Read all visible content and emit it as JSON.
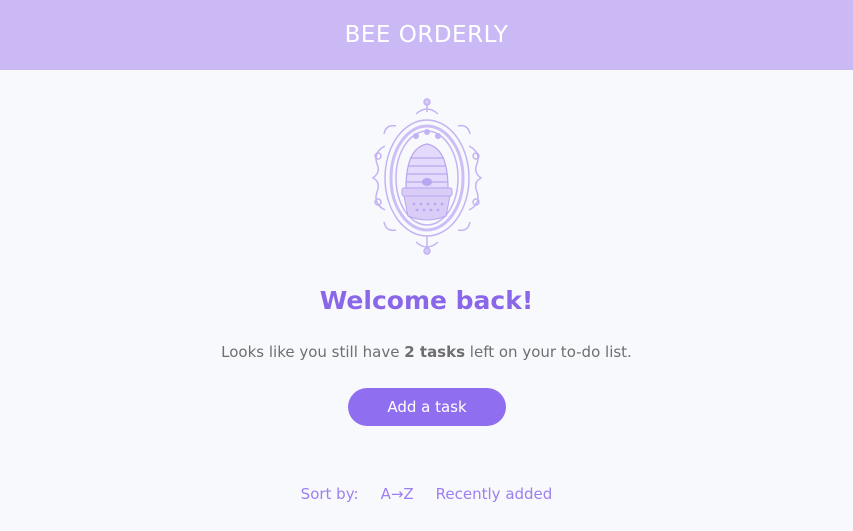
{
  "header": {
    "title": "BEE ORDERLY"
  },
  "hero": {
    "emblem_icon": "beehive-emblem-icon",
    "welcome": "Welcome back!",
    "subtitle_prefix": "Looks like you still have ",
    "task_count": "2 tasks",
    "subtitle_suffix": " left on your to-do list."
  },
  "actions": {
    "add_task_label": "Add a task"
  },
  "sort": {
    "label": "Sort by:",
    "options": [
      "A→Z",
      "Recently added"
    ]
  },
  "colors": {
    "header_bg": "#cbb9f6",
    "accent": "#8f6ff0",
    "heading": "#8a67e8",
    "background": "#f8f9fd"
  }
}
